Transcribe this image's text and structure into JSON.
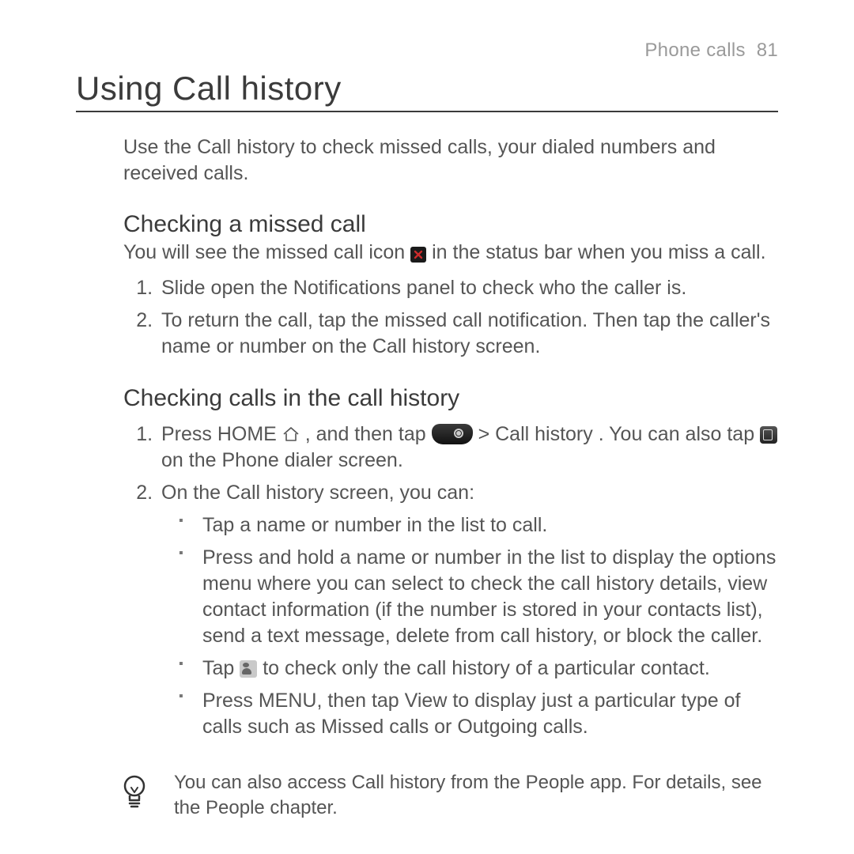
{
  "header": {
    "section": "Phone calls",
    "page_no": "81"
  },
  "title": "Using Call history",
  "intro": "Use the Call history to check missed calls, your dialed numbers and received calls.",
  "sec1": {
    "heading": "Checking a missed call",
    "lead_a": "You will see the missed call icon ",
    "lead_b": " in the status bar when you miss a call.",
    "steps": [
      "Slide open the Notifications panel to check who the caller is.",
      "To return the call, tap the missed call notification. Then tap the caller's name or number on the Call history screen."
    ]
  },
  "sec2": {
    "heading": "Checking calls in the call history",
    "step1": {
      "a": "Press HOME ",
      "b": ", and then tap ",
      "c": " > Call history",
      "d": ". You can also tap ",
      "e": " on the Phone dialer screen."
    },
    "step2": {
      "lead": "On the Call history screen, you can:",
      "bullets": {
        "b1": "Tap a name or number in the list to call.",
        "b2": "Press and hold a name or number in the list to display the options menu where you can select to check the call history details, view contact information (if the number is stored in your contacts list), send a text message, delete from call history, or block the caller.",
        "b3a": "Tap ",
        "b3b": " to check only the call history of a particular contact.",
        "b4a": "Press MENU, then tap ",
        "b4_view": "View",
        "b4b": " to display just a particular type of calls such as Missed calls or Outgoing calls."
      }
    }
  },
  "tip": "You can also access Call history from the People app. For details, see the People chapter."
}
